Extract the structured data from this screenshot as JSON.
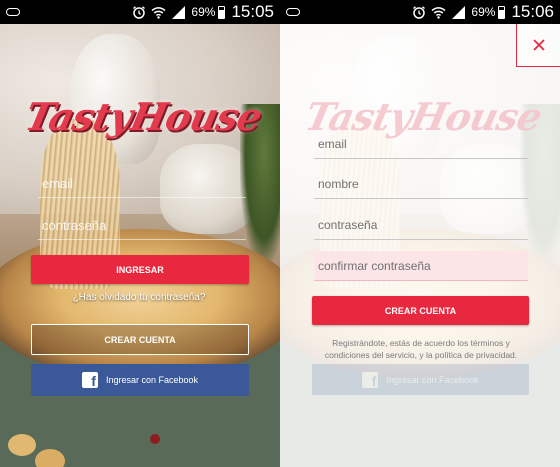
{
  "left_screen": {
    "status_bar": {
      "battery_percent": "69%",
      "time": "15:05"
    },
    "logo_text": "TastyHouse",
    "email_placeholder": "email",
    "password_placeholder": "contraseña",
    "login_button": "INGRESAR",
    "forgot_password": "¿Has olvidado tu contraseña?",
    "create_account_button": "CREAR CUENTA",
    "facebook_button": "Ingresar con Facebook"
  },
  "right_screen": {
    "status_bar": {
      "battery_percent": "69%",
      "time": "15:06"
    },
    "logo_text": "TastyHouse",
    "close_icon_glyph": "×",
    "email_placeholder": "email",
    "name_placeholder": "nombre",
    "password_placeholder": "contraseña",
    "confirm_password_placeholder": "confirmar contraseña",
    "create_account_button": "CREAR CUENTA",
    "terms_text": "Registrándote, estás de acuerdo los términos y condiciones del servicio, y la política de privacidad.",
    "ghost_facebook_button": "Ingresar con Facebook"
  },
  "colors": {
    "accent_red": "#e8283f",
    "facebook_blue": "#3b5998",
    "logo_red": "#e43a4e"
  },
  "icons": [
    "voicemail-icon",
    "alarm-icon",
    "wifi-icon",
    "signal-icon",
    "battery-icon",
    "close-icon",
    "facebook-logo-icon"
  ]
}
